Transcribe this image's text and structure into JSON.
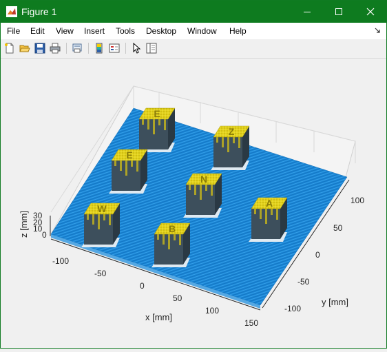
{
  "window": {
    "title": "Figure 1"
  },
  "menu": [
    "File",
    "Edit",
    "View",
    "Insert",
    "Tools",
    "Desktop",
    "Window",
    "Help"
  ],
  "toolbar": {
    "icons": [
      "new-figure-icon",
      "open-file-icon",
      "save-icon",
      "print-icon",
      "print-preview-icon",
      "colorbar-icon",
      "legend-icon",
      "pointer-icon",
      "property-editor-icon"
    ]
  },
  "axes": {
    "xlabel": "x [mm]",
    "ylabel": "y [mm]",
    "zlabel": "z [mm]",
    "xticks": [
      "-100",
      "-50",
      "0",
      "50",
      "100",
      "150"
    ],
    "yticks": [
      "-100",
      "-50",
      "0",
      "50",
      "100"
    ],
    "zticks": [
      "30",
      "20",
      "10",
      "0"
    ]
  },
  "blocks": [
    {
      "letter": "E"
    },
    {
      "letter": "Z"
    },
    {
      "letter": "E"
    },
    {
      "letter": "N"
    },
    {
      "letter": "W"
    },
    {
      "letter": "B"
    },
    {
      "letter": "A"
    }
  ],
  "colors": {
    "titlebar": "#0e7b1f",
    "surface": "#1a84d4",
    "block_top": "#e8d81e",
    "block_side": "#3d4f5c"
  }
}
